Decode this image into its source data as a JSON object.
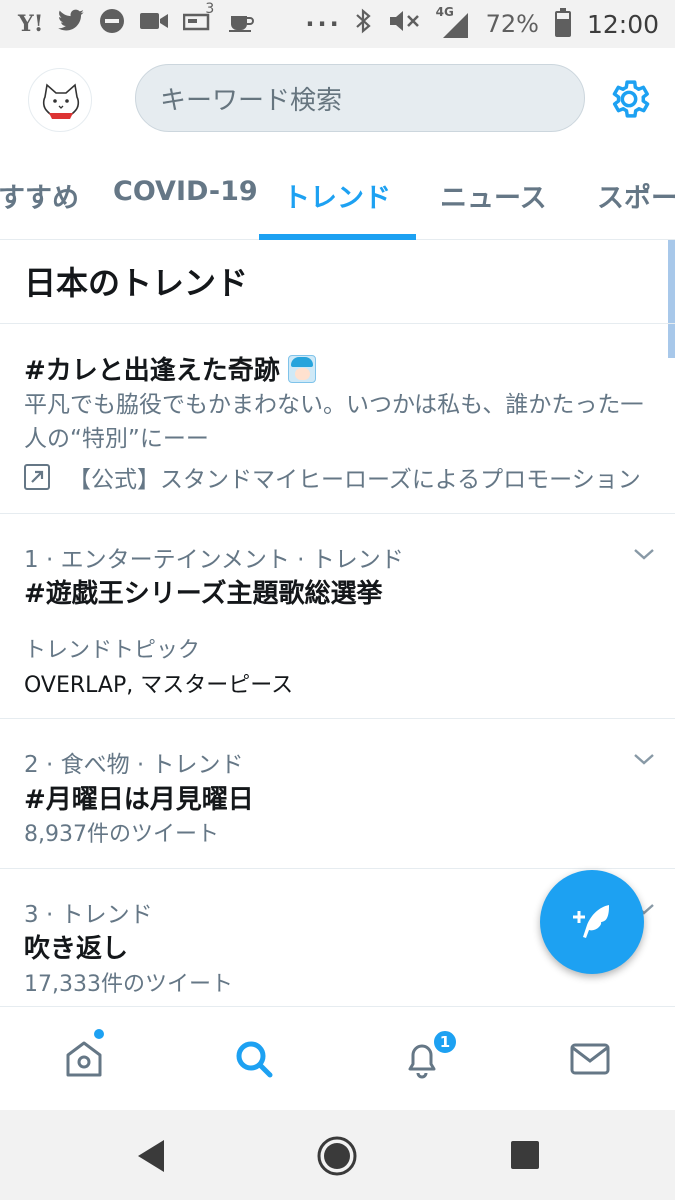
{
  "status_bar": {
    "icons": [
      "yahoo-icon",
      "twitter-icon",
      "do-not-disturb-icon",
      "video-camera-icon",
      "cast-icon",
      "coffee-icon",
      "more-icon",
      "bluetooth-icon",
      "mute-icon",
      "signal-4g-icon",
      "battery-icon"
    ],
    "yahoo_text": "Y!",
    "notif_count": "3",
    "network": "4G",
    "battery": "72%",
    "battery_level": 0.72,
    "time": "12:00"
  },
  "header": {
    "search_placeholder": "キーワード検索",
    "settings_icon": "gear-icon"
  },
  "tabs": [
    {
      "label": "すすめ"
    },
    {
      "label": "COVID-19"
    },
    {
      "label": "トレンド",
      "active": true
    },
    {
      "label": "ニュース"
    },
    {
      "label": "スポー"
    }
  ],
  "section": {
    "title": "日本のトレンド"
  },
  "promoted": {
    "title": "#カレと出逢えた奇跡",
    "description": "平凡でも脇役でもかまわない。いつかは私も、誰かたった一人の“特別”にーー",
    "promoted_by": "【公式】スタンドマイヒーローズによるプロモーション"
  },
  "trends": [
    {
      "meta": "1 · エンターテインメント · トレンド",
      "name": "#遊戯王シリーズ主題歌総選挙",
      "sub_label": "トレンドトピック",
      "sub_value": "OVERLAP, マスターピース"
    },
    {
      "meta": "2 · 食べ物 · トレンド",
      "name": "#月曜日は月見曜日",
      "count": "8,937件のツイート"
    },
    {
      "meta": "3 · トレンド",
      "name": "吹き返し",
      "count": "17,333件のツイート"
    }
  ],
  "bottom_nav": {
    "items": [
      "home-icon",
      "search-icon",
      "notifications-icon",
      "messages-icon"
    ],
    "notification_badge": "1",
    "active": "search"
  },
  "colors": {
    "accent": "#1da1f2",
    "secondary_text": "#657786",
    "divider": "#e6ecf0"
  }
}
